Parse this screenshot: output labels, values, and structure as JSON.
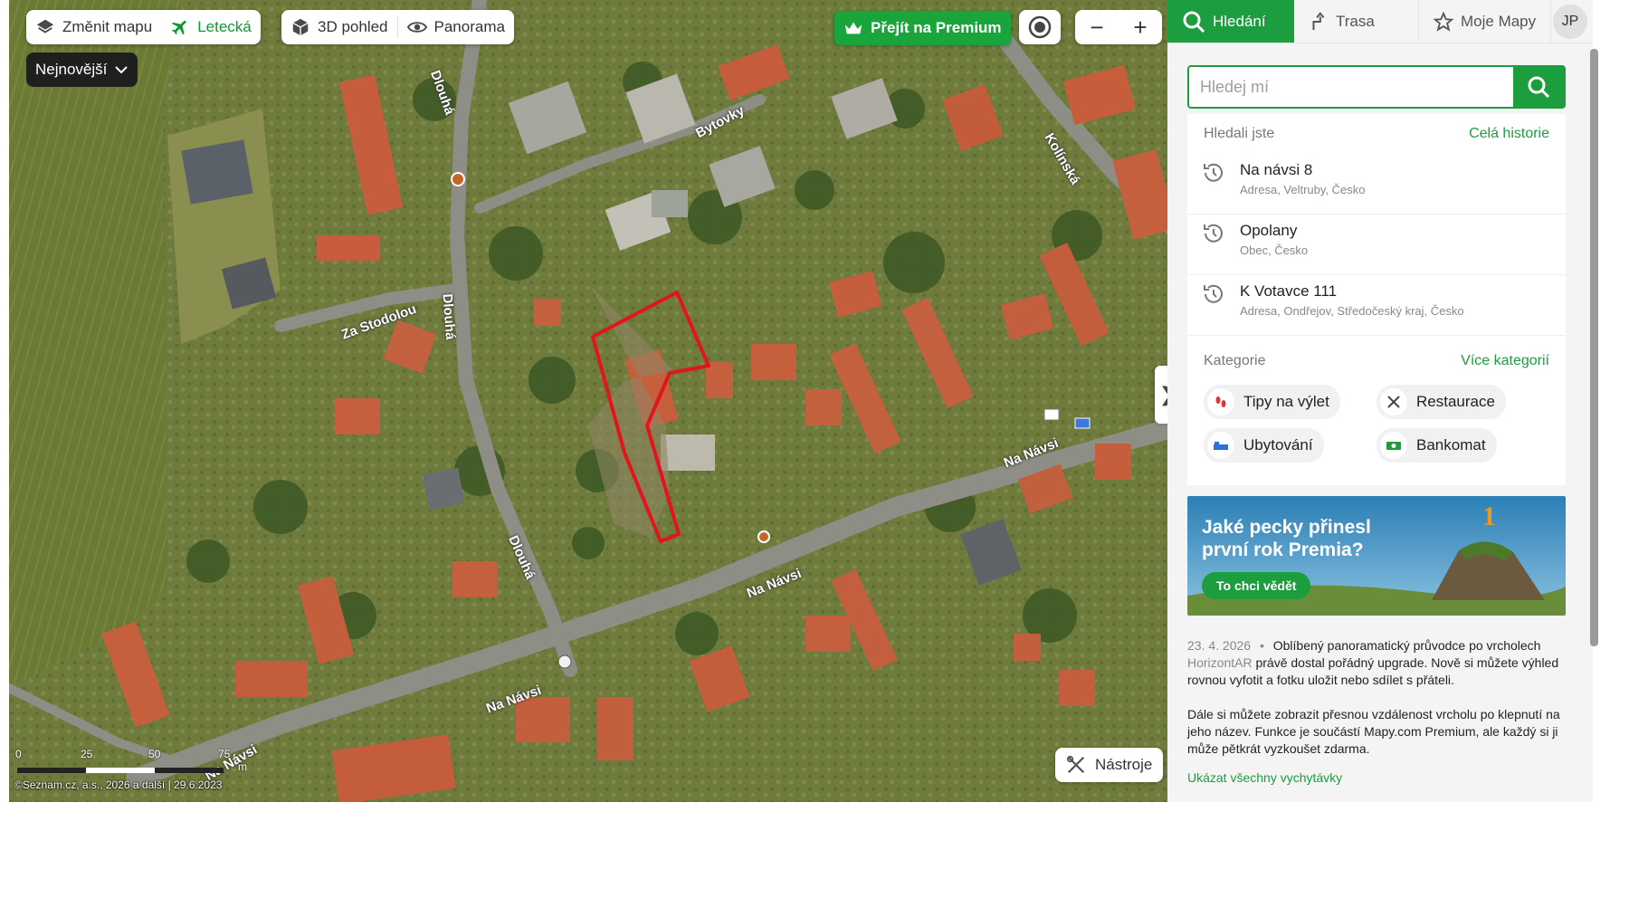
{
  "map_controls": {
    "change_map_label": "Změnit mapu",
    "aerial_label": "Letecká",
    "view_3d_label": "3D pohled",
    "panorama_label": "Panorama",
    "sort_label": "Nejnovější",
    "premium_label": "Přejít na Premium",
    "zoom_out": "−",
    "zoom_in": "+",
    "tools_label": "Nástroje",
    "collapse_glyph": "❯"
  },
  "map": {
    "road_labels": {
      "bytovky": "Bytovky",
      "kolinska": "Kolínská",
      "dlouha_top": "Dlouhá",
      "dlouha_mid": "Dlouhá",
      "dlouha_low": "Dlouhá",
      "za_stodolou": "Za Stodolou",
      "na_navsi_1": "Na Návsi",
      "na_navsi_2": "Na Návsi",
      "na_navsi_3": "Na Návsi",
      "na_navsi_4": "Na Návsi"
    },
    "scale": {
      "t0": "0",
      "t1": "25",
      "t2": "50",
      "t3": "75",
      "unit": "m"
    },
    "copyright": "©Seznam.cz, a.s., 2026 a další | 29.6.2023"
  },
  "nav": {
    "search_tab": "Hledání",
    "route_tab": "Trasa",
    "mymaps_tab": "Moje Mapy",
    "avatar": "JP"
  },
  "search": {
    "value": "",
    "placeholder": "Hledej mí"
  },
  "history": {
    "heading": "Hledali jste",
    "all_link": "Celá historie",
    "items": [
      {
        "title": "Na návsi 8",
        "subtitle": "Adresa, Veltruby, Česko"
      },
      {
        "title": "Opolany",
        "subtitle": "Obec, Česko"
      },
      {
        "title": "K Votavce 111",
        "subtitle": "Adresa, Ondřejov, Středočeský kraj, Česko"
      }
    ]
  },
  "categories": {
    "heading": "Kategorie",
    "more_link": "Více kategorií",
    "items": [
      {
        "label": "Tipy na výlet"
      },
      {
        "label": "Restaurace"
      },
      {
        "label": "Ubytování"
      },
      {
        "label": "Bankomat"
      }
    ]
  },
  "promo": {
    "title": "Jaké pecky přinesl první rok Premia?",
    "cta": "To chci vědět",
    "badge": "1"
  },
  "news": {
    "date": "23. 4. 2026",
    "bullet": "•",
    "p1_a": "Oblíbený panoramatický průvodce po vrcholech",
    "p1_link": "HorizontAR",
    "p1_b": "právě dostal pořádný upgrade. Nově si můžete výhled rovnou vyfotit a fotku uložit nebo sdílet s přáteli.",
    "p2": "Dále si můžete zobrazit přesnou vzdálenost vrcholu po klepnutí na jeho název. Funkce je součástí Mapy.com Premium, ale každý si ji může pětkrát vyzkoušet zdarma.",
    "more": "Ukázat všechny vychytávky"
  },
  "colors": {
    "accent": "#1c9e3e",
    "parcel_outline": "#e3141b"
  }
}
